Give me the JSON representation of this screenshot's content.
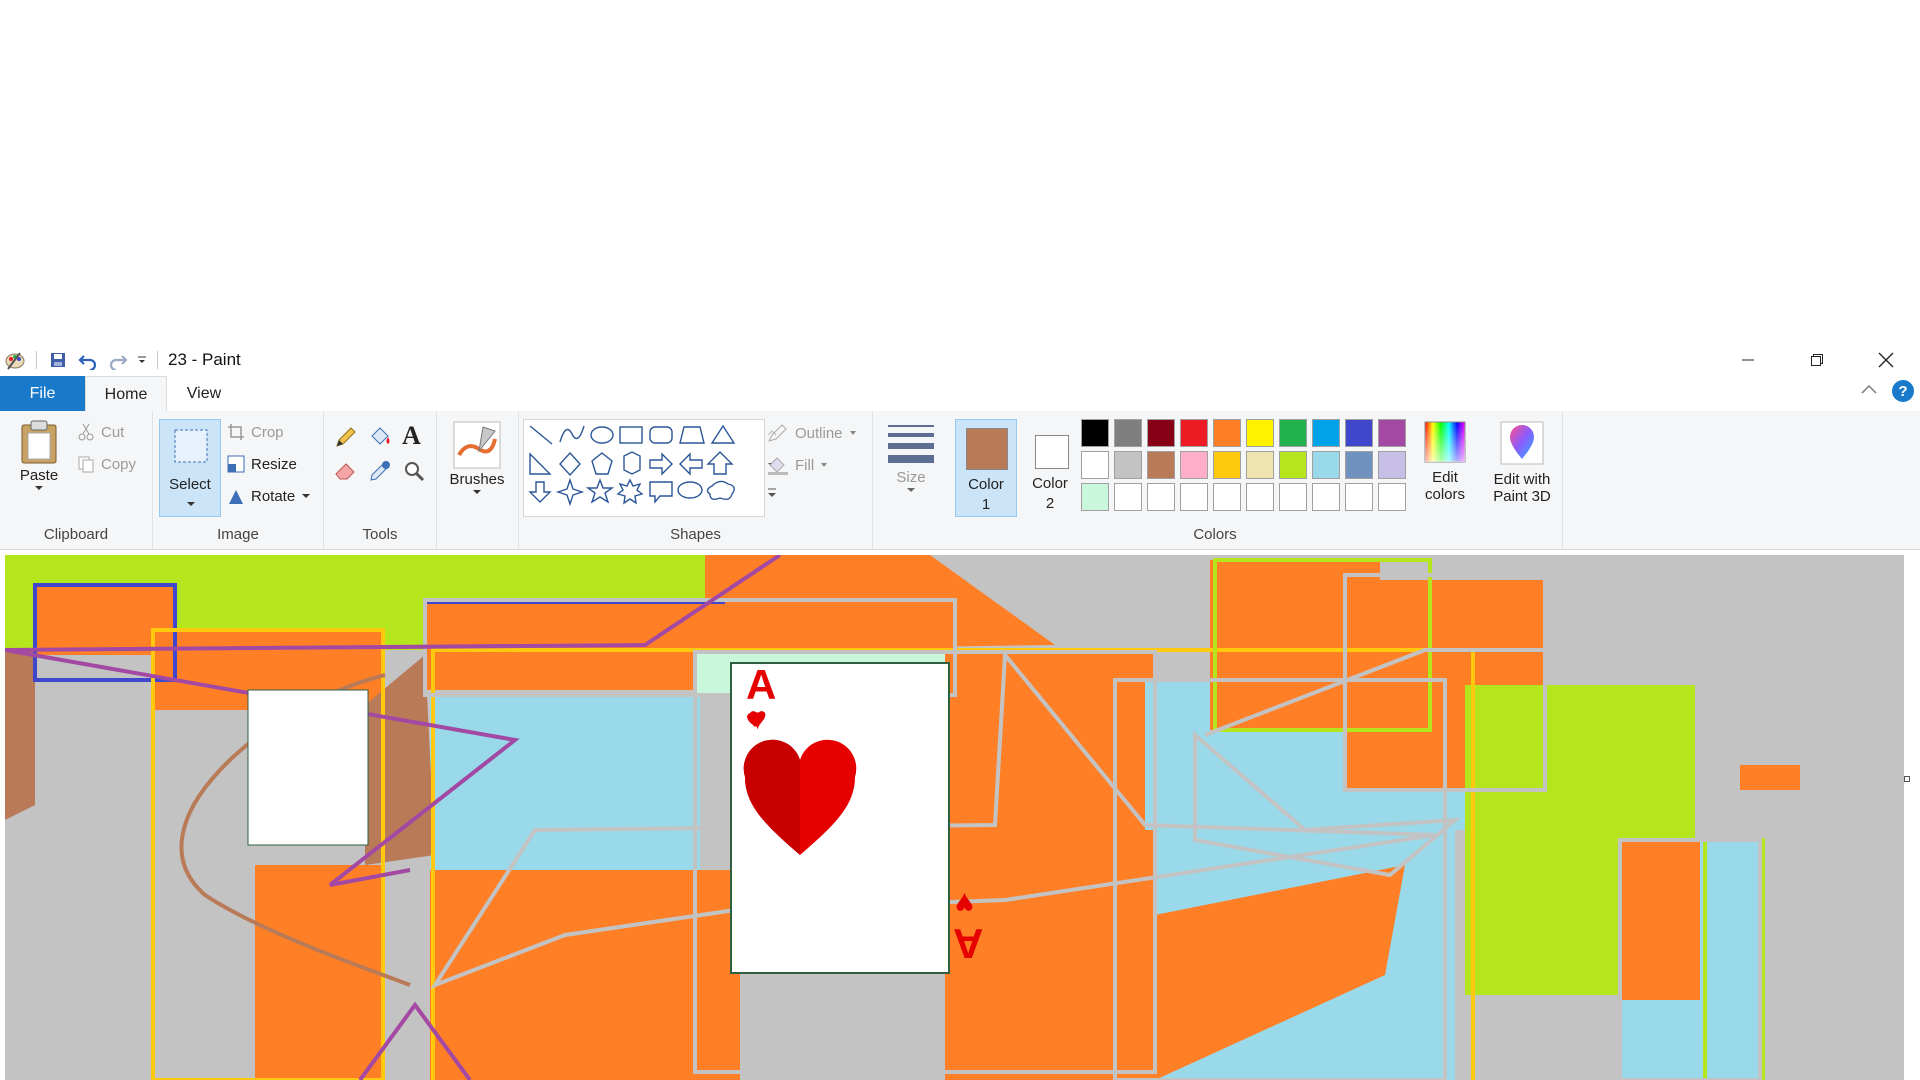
{
  "window": {
    "title": "23 - Paint"
  },
  "tabs": {
    "file": "File",
    "home": "Home",
    "view": "View"
  },
  "clipboard": {
    "paste": "Paste",
    "cut": "Cut",
    "copy": "Copy",
    "group": "Clipboard"
  },
  "image": {
    "select": "Select",
    "crop": "Crop",
    "resize": "Resize",
    "rotate": "Rotate",
    "group": "Image"
  },
  "tools": {
    "group": "Tools"
  },
  "brushes": {
    "label": "Brushes"
  },
  "shapes": {
    "outline": "Outline",
    "fill": "Fill",
    "group": "Shapes"
  },
  "size": {
    "label": "Size"
  },
  "colors": {
    "color1_line1": "Color",
    "color1_line2": "1",
    "color2_line1": "Color",
    "color2_line2": "2",
    "edit_line1": "Edit",
    "edit_line2": "colors",
    "paint3d_line1": "Edit with",
    "paint3d_line2": "Paint 3D",
    "group": "Colors",
    "color1_value": "#b97a57",
    "color2_value": "#ffffff",
    "palette_row1": [
      "#000000",
      "#7f7f7f",
      "#880015",
      "#ed1c24",
      "#ff7f27",
      "#fff200",
      "#22b14c",
      "#00a2e8",
      "#3f48cc",
      "#a349a4"
    ],
    "palette_row2": [
      "#ffffff",
      "#c3c3c3",
      "#b97a57",
      "#ffaec9",
      "#ffc90e",
      "#efe4b0",
      "#b5e61d",
      "#99d9ea",
      "#7092be",
      "#c8bfe7"
    ],
    "palette_row3": [
      "#c8f7dc",
      "#ffffff",
      "#ffffff",
      "#ffffff",
      "#ffffff",
      "#ffffff",
      "#ffffff",
      "#ffffff",
      "#ffffff",
      "#ffffff"
    ]
  },
  "card": {
    "rank": "A",
    "suit": "♥"
  }
}
